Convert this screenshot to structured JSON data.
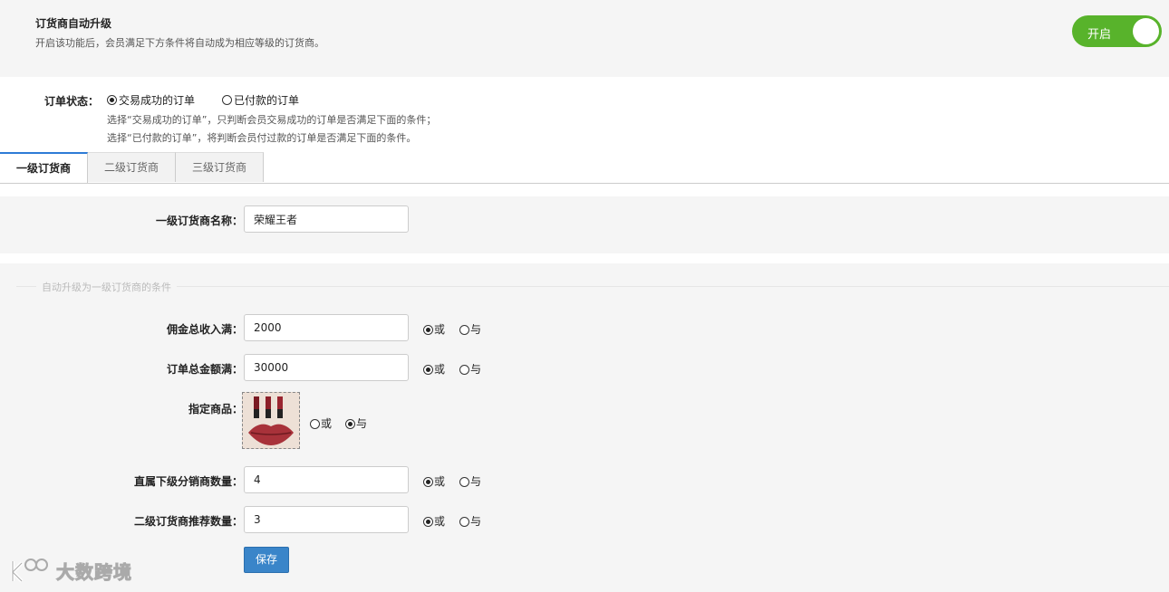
{
  "top": {
    "title": "订货商自动升级",
    "description": "开启该功能后，会员满足下方条件将自动成为相应等级的订货商。",
    "toggle_label": "开启",
    "toggle_on": true,
    "toggle_color": "#58b32b"
  },
  "order_status": {
    "label": "订单状态：",
    "options": [
      "交易成功的订单",
      "已付款的订单"
    ],
    "selected": 0,
    "hints": [
      "选择“交易成功的订单”，只判断会员交易成功的订单是否满足下面的条件；",
      "选择“已付款的订单”，将判断会员付过款的订单是否满足下面的条件。"
    ]
  },
  "tabs": [
    "一级订货商",
    "二级订货商",
    "三级订货商"
  ],
  "active_tab": 0,
  "name_field": {
    "label": "一级订货商名称：",
    "value": "荣耀王者"
  },
  "conditions": {
    "legend": "自动升级为一级订货商的条件",
    "or_label": "或",
    "and_label": "与",
    "fields": [
      {
        "label": "佣金总收入满：",
        "value": "2000",
        "mode": "or"
      },
      {
        "label": "订单总金额满：",
        "value": "30000",
        "mode": "or"
      },
      {
        "label": "指定商品：",
        "product_image": "lipstick-product-image",
        "mode": "and"
      },
      {
        "label": "直属下级分销商数量：",
        "value": "4",
        "mode": "or"
      },
      {
        "label": "二级订货商推荐数量：",
        "value": "3",
        "mode": "or"
      }
    ]
  },
  "save_label": "保存",
  "watermark_text": "大数跨境",
  "accent_color": "#3a85c9"
}
